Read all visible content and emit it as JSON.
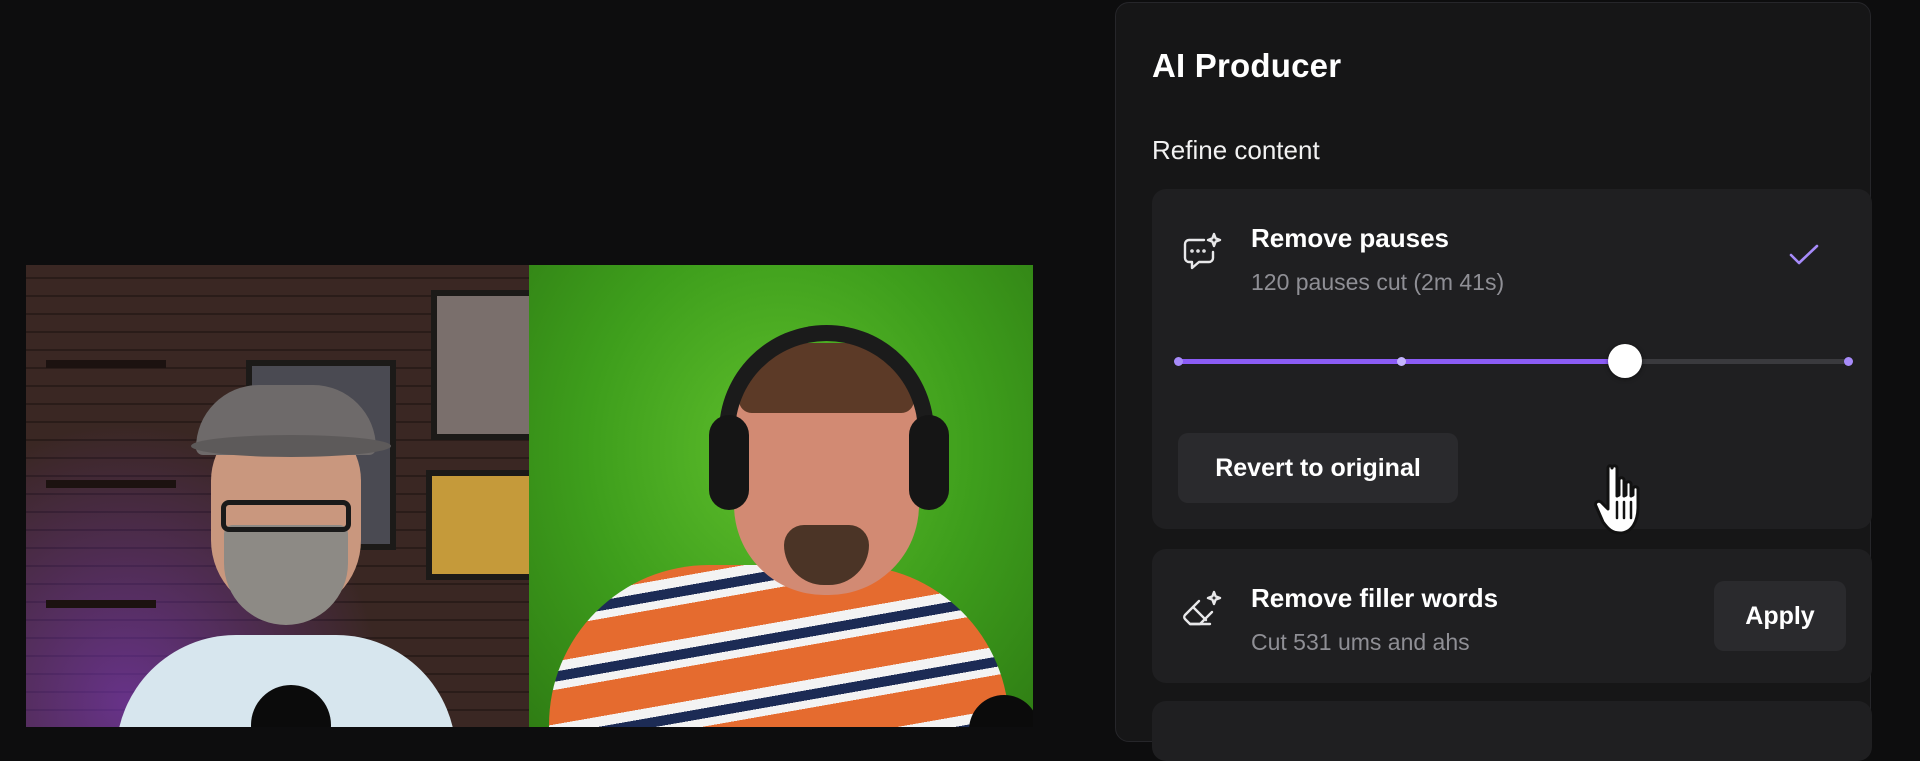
{
  "panel": {
    "title": "AI Producer",
    "section_title": "Refine content"
  },
  "remove_pauses": {
    "icon": "chat-sparkle-icon",
    "title": "Remove pauses",
    "subtitle": "120 pauses cut (2m 41s)",
    "checked": true,
    "slider_level": 0.667,
    "slider_stops": [
      0,
      0.333,
      0.667,
      1
    ],
    "revert_label": "Revert to original"
  },
  "remove_filler": {
    "icon": "eraser-sparkle-icon",
    "title": "Remove filler words",
    "subtitle": "Cut 531 ums and ahs",
    "apply_label": "Apply"
  },
  "colors": {
    "accent": "#8b5cf6",
    "panel_bg": "#161617",
    "card_bg": "#1f1f21",
    "button_bg": "#2a2a2d",
    "muted_text": "#8f8f95"
  }
}
